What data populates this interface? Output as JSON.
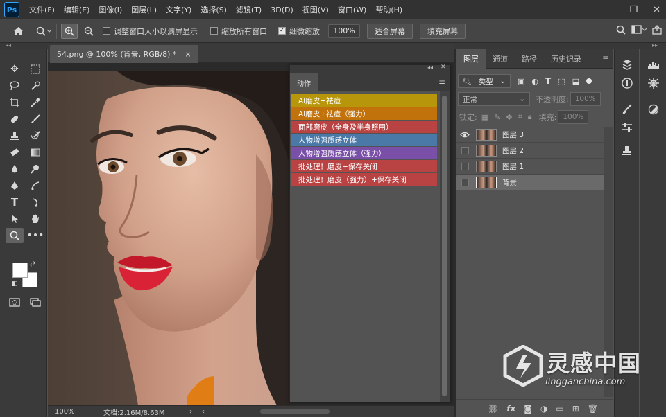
{
  "app": {
    "logo_text": "Ps"
  },
  "menu": [
    "文件(F)",
    "编辑(E)",
    "图像(I)",
    "图层(L)",
    "文字(Y)",
    "选择(S)",
    "滤镜(T)",
    "3D(D)",
    "视图(V)",
    "窗口(W)",
    "帮助(H)"
  ],
  "window_controls": {
    "minimize": "—",
    "restore": "❐",
    "close": "✕"
  },
  "options_bar": {
    "home_icon": "home-icon",
    "resize_windows_label": "调整窗口大小以满屏显示",
    "zoom_all_windows_label": "缩放所有窗口",
    "scrubby_zoom_label": "细微缩放",
    "zoom_value": "100%",
    "fit_screen_label": "适合屏幕",
    "fill_screen_label": "填充屏幕",
    "resize_windows_checked": false,
    "zoom_all_windows_checked": false,
    "scrubby_zoom_checked": true
  },
  "document": {
    "tab_title": "54.png @ 100% (背景, RGB/8) *",
    "tab_close": "×",
    "zoom": "100%",
    "doc_info": "文档:2.16M/8.63M"
  },
  "actions_panel": {
    "tab": "动作",
    "menu_icon": "≡",
    "items": [
      {
        "label": "AI磨皮+祛痘",
        "color": "#b8960c"
      },
      {
        "label": "AI磨皮+祛痘（强力）",
        "color": "#c2720b"
      },
      {
        "label": "面部磨皮（全身及半身照用）",
        "color": "#b94343"
      },
      {
        "label": "人物增强质感立体",
        "color": "#4a79a8"
      },
      {
        "label": "人物增强质感立体（强力）",
        "color": "#7a4fa8"
      },
      {
        "label": "批处理！磨皮+保存关闭",
        "color": "#b94343"
      },
      {
        "label": "批处理！磨皮（强力）+保存关闭",
        "color": "#b94343"
      }
    ]
  },
  "layers_panel": {
    "tabs": [
      "图层",
      "通道",
      "路径",
      "历史记录"
    ],
    "filter_kind": "类型",
    "blend_mode": "正常",
    "opacity_label": "不透明度:",
    "opacity_value": "100%",
    "lock_label": "锁定:",
    "fill_label": "填充:",
    "fill_value": "100%",
    "layers": [
      {
        "name": "图层 3",
        "visible": true,
        "selected": false
      },
      {
        "name": "图层 2",
        "visible": false,
        "selected": false
      },
      {
        "name": "图层 1",
        "visible": false,
        "selected": false
      },
      {
        "name": "背景",
        "visible": false,
        "selected": true
      }
    ],
    "bottom_icons": [
      "link-icon",
      "fx-icon",
      "mask-icon",
      "adjustment-icon",
      "group-icon",
      "new-layer-icon",
      "trash-icon"
    ]
  },
  "watermark": {
    "brand": "灵感中国",
    "url": "lingganchina.com"
  },
  "colors": {
    "menubar": "#323232",
    "panel": "#535353",
    "toolbar": "#3a3a3a"
  }
}
